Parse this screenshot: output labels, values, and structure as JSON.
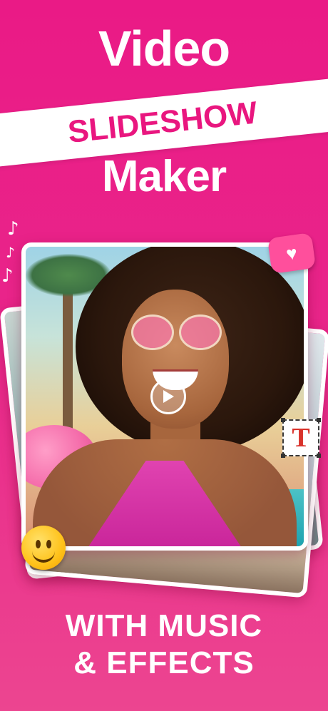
{
  "headline": {
    "line1": "Video",
    "line2": "SLIDESHOW",
    "line3": "Maker"
  },
  "tagline": {
    "line1": "WITH MUSIC",
    "line2": "& EFFECTS"
  },
  "icons": {
    "play": "play-icon",
    "heart": "heart-sticker-icon",
    "text": "text-tool-icon",
    "emoji": "smiley-emoji-icon",
    "music": "music-note-icon"
  },
  "colors": {
    "background": "#ea1a86",
    "banner": "#ffffff",
    "banner_text": "#e9167f",
    "text": "#ffffff"
  },
  "text_tool_glyph": "T",
  "heart_glyph": "♥",
  "note_glyph": "♪"
}
